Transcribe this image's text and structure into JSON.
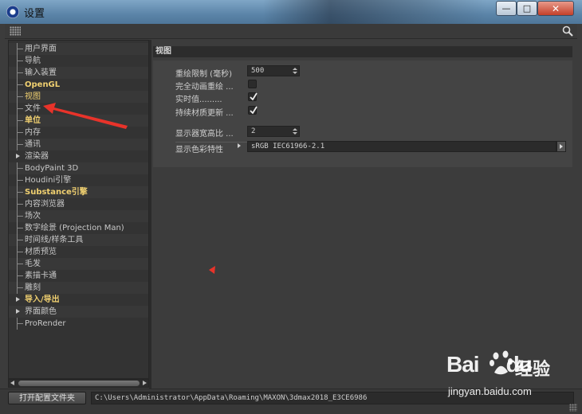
{
  "window": {
    "title": "设置",
    "controls": {
      "minimize": "—",
      "maximize": "□",
      "close": "✕"
    }
  },
  "toolbar": {
    "grip_icon": "grip-icon",
    "search_icon": "search-icon"
  },
  "nav": {
    "items": [
      {
        "label": "用户界面",
        "style": "normal",
        "expandable": false
      },
      {
        "label": "导航",
        "style": "normal",
        "expandable": false
      },
      {
        "label": "输入装置",
        "style": "normal",
        "expandable": false
      },
      {
        "label": "OpenGL",
        "style": "highlight-bold",
        "expandable": false
      },
      {
        "label": "视图",
        "style": "highlight",
        "expandable": false
      },
      {
        "label": "文件",
        "style": "normal",
        "expandable": false
      },
      {
        "label": "单位",
        "style": "highlight-bold",
        "expandable": false
      },
      {
        "label": "内存",
        "style": "normal",
        "expandable": false
      },
      {
        "label": "通讯",
        "style": "normal",
        "expandable": false
      },
      {
        "label": "渲染器",
        "style": "normal",
        "expandable": true
      },
      {
        "label": "BodyPaint 3D",
        "style": "normal",
        "expandable": false
      },
      {
        "label": "Houdini引擎",
        "style": "normal",
        "expandable": false
      },
      {
        "label": "Substance引擎",
        "style": "highlight-bold",
        "expandable": false
      },
      {
        "label": "内容浏览器",
        "style": "normal",
        "expandable": false
      },
      {
        "label": "场次",
        "style": "normal",
        "expandable": false
      },
      {
        "label": "数字绘景 (Projection Man)",
        "style": "normal",
        "expandable": false
      },
      {
        "label": "时间线/样条工具",
        "style": "normal",
        "expandable": false
      },
      {
        "label": "材质预览",
        "style": "normal",
        "expandable": false
      },
      {
        "label": "毛发",
        "style": "normal",
        "expandable": false
      },
      {
        "label": "素描卡通",
        "style": "normal",
        "expandable": false
      },
      {
        "label": "雕刻",
        "style": "normal",
        "expandable": false
      },
      {
        "label": "导入/导出",
        "style": "highlight-bold",
        "expandable": true
      },
      {
        "label": "界面颜色",
        "style": "normal",
        "expandable": true
      },
      {
        "label": "ProRender",
        "style": "normal",
        "expandable": false
      }
    ]
  },
  "panel": {
    "section_title": "视图",
    "redraw_limit": {
      "label": "重绘限制 (毫秒)",
      "value": "500"
    },
    "full_anim_redraw": {
      "label": "完全动画重绘 ...",
      "checked": false
    },
    "realtime_value": {
      "label": "实时值.........",
      "checked": true
    },
    "continuous_material_update": {
      "label": "持续材质更新 ...",
      "checked": true
    },
    "display_aspect": {
      "label": "显示器宽高比 ...",
      "value": "2"
    },
    "display_color_profile": {
      "label": "显示色彩特性",
      "value": "sRGB IEC61966-2.1"
    }
  },
  "bottom": {
    "open_config_button": "打开配置文件夹",
    "config_path": "C:\\Users\\Administrator\\AppData\\Roaming\\MAXON\\3dmax2018_E3CE6986"
  },
  "watermark": {
    "logo": "Bai",
    "logo_suffix": "du",
    "brand_text": "经验",
    "url": "jingyan.baidu.com"
  },
  "colors": {
    "highlight": "#f0d070",
    "annotation_red": "#e8332a",
    "panel_bg": "#3c3c3c"
  }
}
